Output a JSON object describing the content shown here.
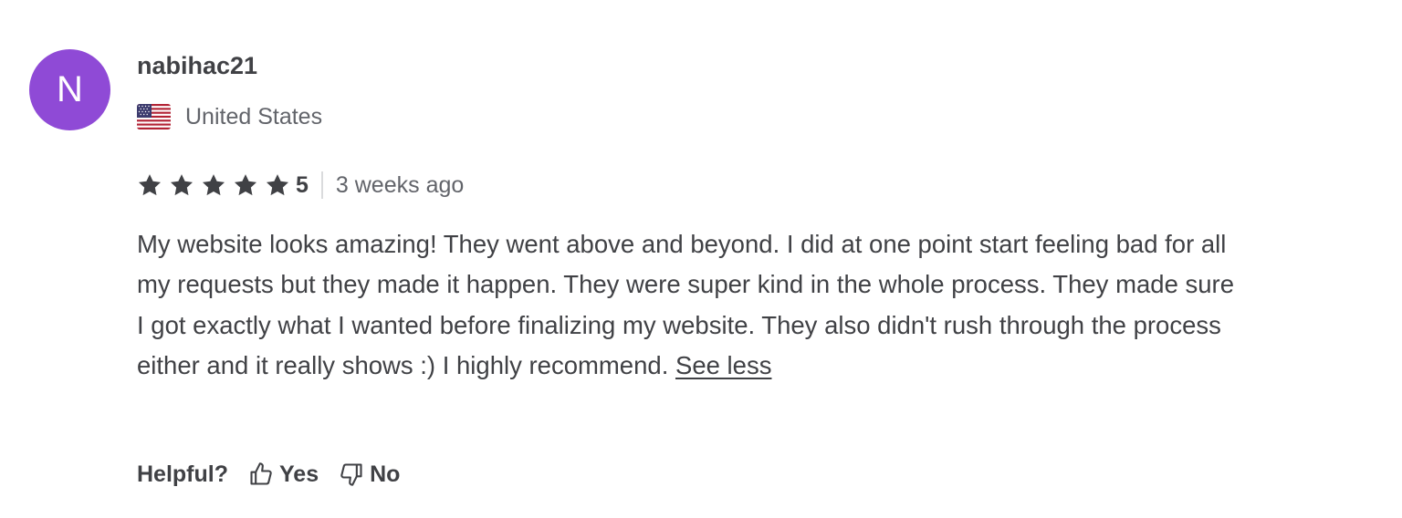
{
  "reviewer": {
    "avatar_initial": "N",
    "avatar_color": "#8f4ad6",
    "username": "nabihac21",
    "country_flag_icon": "us-flag-icon",
    "country": "United States"
  },
  "rating": {
    "stars": 5,
    "max_stars": 5,
    "value_text": "5",
    "time_ago": "3 weeks ago"
  },
  "review": {
    "text": "My website looks amazing! They went above and beyond. I did at one point start feeling bad for all my requests but they made it happen. They were super kind in the whole process. They made sure I got exactly what I wanted before finalizing my website. They also didn't rush through the process either and it really shows :) I highly recommend.",
    "toggle_label": "See less"
  },
  "helpful": {
    "label": "Helpful?",
    "yes_label": "Yes",
    "no_label": "No",
    "yes_icon": "thumbs-up-icon",
    "no_icon": "thumbs-down-icon"
  },
  "colors": {
    "text_primary": "#404145",
    "text_secondary": "#62646a",
    "star": "#404145"
  }
}
